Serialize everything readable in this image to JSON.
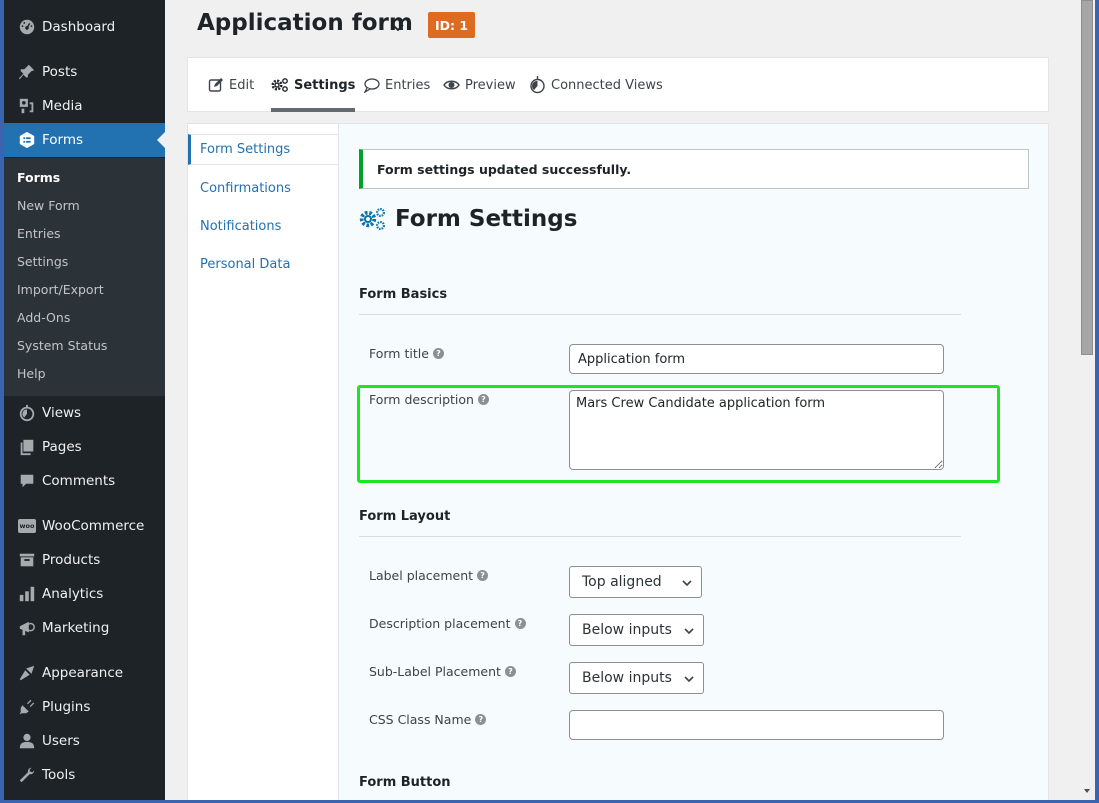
{
  "sidebar": {
    "items": [
      {
        "label": "Dashboard",
        "icon": "dashboard-icon"
      },
      {
        "label": "Posts",
        "icon": "pin-icon"
      },
      {
        "label": "Media",
        "icon": "media-icon"
      },
      {
        "label": "Forms",
        "icon": "forms-icon",
        "active": true
      },
      {
        "label": "Views",
        "icon": "stopwatch-icon"
      },
      {
        "label": "Pages",
        "icon": "pages-icon"
      },
      {
        "label": "Comments",
        "icon": "comment-icon"
      },
      {
        "label": "WooCommerce",
        "icon": "woo-icon"
      },
      {
        "label": "Products",
        "icon": "archive-icon"
      },
      {
        "label": "Analytics",
        "icon": "bar-chart-icon"
      },
      {
        "label": "Marketing",
        "icon": "megaphone-icon"
      },
      {
        "label": "Appearance",
        "icon": "paintbrush-icon"
      },
      {
        "label": "Plugins",
        "icon": "plug-icon"
      },
      {
        "label": "Users",
        "icon": "user-icon"
      },
      {
        "label": "Tools",
        "icon": "wrench-icon"
      }
    ],
    "submenu": [
      "Forms",
      "New Form",
      "Entries",
      "Settings",
      "Import/Export",
      "Add-Ons",
      "System Status",
      "Help"
    ],
    "woo_icon_text": "woo"
  },
  "header": {
    "title": "Application form",
    "id_badge": "ID: 1"
  },
  "tabs": [
    {
      "label": "Edit",
      "icon": "edit-icon"
    },
    {
      "label": "Settings",
      "icon": "gears-icon",
      "active": true
    },
    {
      "label": "Entries",
      "icon": "speech-bubble-icon"
    },
    {
      "label": "Preview",
      "icon": "eye-icon"
    },
    {
      "label": "Connected Views",
      "icon": "stopwatch-icon"
    }
  ],
  "subnav": [
    "Form Settings",
    "Confirmations",
    "Notifications",
    "Personal Data"
  ],
  "notice": "Form settings updated successfully.",
  "main": {
    "heading": "Form Settings",
    "form_basics": {
      "title": "Form Basics",
      "form_title_label": "Form title",
      "form_title_value": "Application form",
      "form_description_label": "Form description",
      "form_description_value": "Mars Crew Candidate application form"
    },
    "form_layout": {
      "title": "Form Layout",
      "label_placement_label": "Label placement",
      "label_placement_value": "Top aligned",
      "description_placement_label": "Description placement",
      "description_placement_value": "Below inputs",
      "sublabel_placement_label": "Sub-Label Placement",
      "sublabel_placement_value": "Below inputs",
      "css_class_label": "CSS Class Name",
      "css_class_value": ""
    },
    "form_button": {
      "title": "Form Button"
    },
    "help_glyph": "?"
  },
  "colors": {
    "accent": "#2271b1",
    "sidebar_bg": "#1d2327",
    "badge": "#dd6b20",
    "success": "#00a32a",
    "highlight": "#1ee61e"
  }
}
